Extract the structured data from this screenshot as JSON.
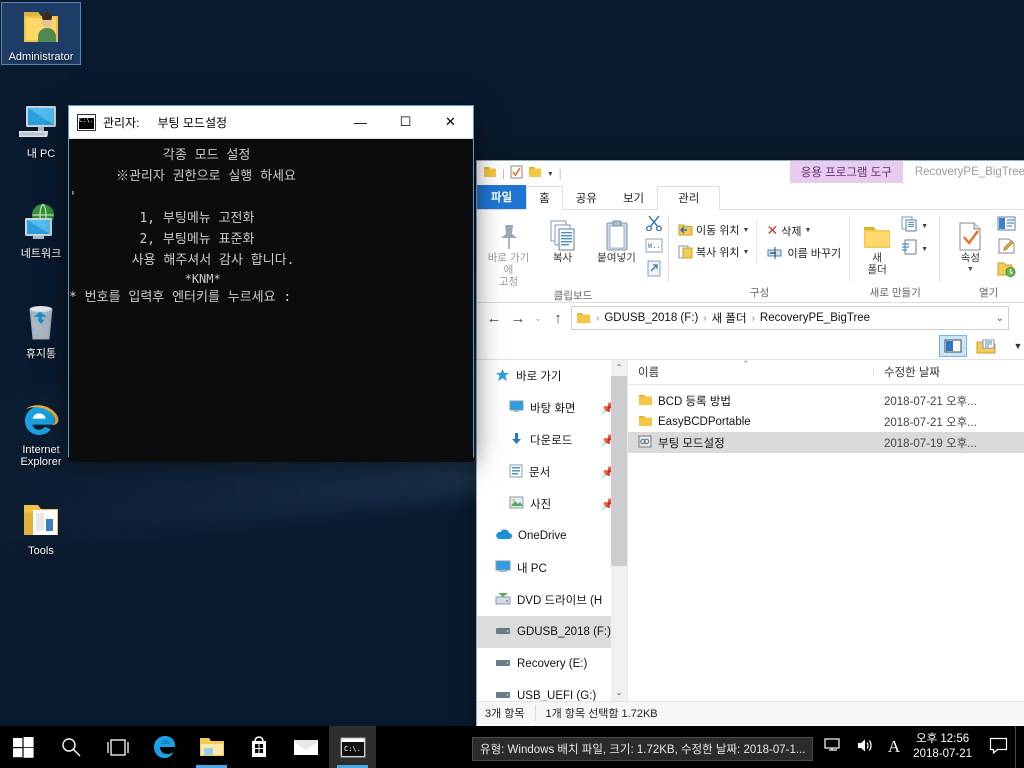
{
  "desktop": {
    "icons": [
      {
        "label": "Administrator",
        "icon": "user-folder-icon",
        "selected": true
      },
      {
        "label": "내 PC",
        "icon": "this-pc-icon",
        "selected": false
      },
      {
        "label": "네트워크",
        "icon": "network-icon",
        "selected": false
      },
      {
        "label": "휴지통",
        "icon": "recycle-bin-icon",
        "selected": false
      },
      {
        "label": "Internet Explorer",
        "icon": "internet-explorer-icon",
        "selected": false
      },
      {
        "label": "Tools",
        "icon": "tools-folder-icon",
        "selected": false
      }
    ]
  },
  "console": {
    "title_prefix": "관리자:",
    "title": "부팅 모드설정",
    "icon": "console-window-icon",
    "minimize": "—",
    "maximize": "☐",
    "close": "✕",
    "lines": [
      "",
      "            각종 모드 설정",
      "",
      "      ※관리자 권한으로 실행 하세요",
      "",
      "'",
      "         1, 부팅메뉴 고전화",
      "",
      "         2, 부팅메뉴 표준화",
      "",
      "",
      "        사용 해주셔서 감사 합니다.",
      "                *KNM*",
      "",
      "* 번호를 입력후 엔터키를 누르세요 :"
    ]
  },
  "explorer": {
    "quick_access": [
      "folder-icon",
      "checkbox-doc-icon",
      "folder-icon",
      "dropdown-icon"
    ],
    "context_tab_label": "응용 프로그램 도구",
    "window_title": "RecoveryPE_BigTree",
    "tabs": [
      {
        "label": "파일",
        "kind": "file"
      },
      {
        "label": "홈",
        "kind": "active"
      },
      {
        "label": "공유",
        "kind": "normal"
      },
      {
        "label": "보기",
        "kind": "normal"
      },
      {
        "label": "관리",
        "kind": "ctx"
      }
    ],
    "ribbon": {
      "groups": [
        {
          "label": "클립보드",
          "big": [
            {
              "label": "바로 가기에\n고정",
              "icon": "pin-icon",
              "dim": true
            },
            {
              "label": "복사",
              "icon": "copy-icon",
              "dim": false
            },
            {
              "label": "붙여넣기",
              "icon": "paste-icon",
              "dim": false
            }
          ],
          "small": [
            {
              "label": "",
              "icon": "cut-icon"
            },
            {
              "label": "",
              "icon": "copy-path-icon"
            },
            {
              "label": "",
              "icon": "paste-shortcut-icon"
            }
          ]
        },
        {
          "label": "구성",
          "small": [
            {
              "label": "이동 위치",
              "icon": "move-to-icon",
              "caret": true
            },
            {
              "label": "복사 위치",
              "icon": "copy-to-icon",
              "caret": true
            },
            {
              "label": "삭제",
              "icon": "delete-x-icon",
              "caret": true
            },
            {
              "label": "이름 바꾸기",
              "icon": "rename-icon",
              "caret": false
            }
          ]
        },
        {
          "label": "새로 만들기",
          "big": [
            {
              "label": "새\n폴더",
              "icon": "new-folder-icon",
              "dim": false
            }
          ],
          "small": [
            {
              "label": "",
              "icon": "new-item-icon",
              "caret": true
            },
            {
              "label": "",
              "icon": "easy-access-icon",
              "caret": true
            }
          ]
        },
        {
          "label": "열기",
          "big": [
            {
              "label": "속성",
              "icon": "properties-icon",
              "dim": false,
              "caret": true
            }
          ],
          "small": [
            {
              "label": "",
              "icon": "open-icon"
            },
            {
              "label": "",
              "icon": "edit-icon"
            },
            {
              "label": "",
              "icon": "history-icon"
            }
          ]
        }
      ]
    },
    "addressbar": {
      "back": "←",
      "forward": "→",
      "recent": "⌄",
      "up": "↑",
      "crumbs": [
        "GDUSB_2018 (F:)",
        "새 폴더",
        "RecoveryPE_BigTree"
      ],
      "crumb_sep": "›",
      "dropdown": "⌄"
    },
    "viewbuttons": [
      {
        "icon": "details-pane-icon",
        "active": true
      },
      {
        "icon": "preview-layout-icon",
        "active": false
      },
      {
        "icon": "options-caret-icon",
        "active": false
      }
    ],
    "navpane": {
      "items": [
        {
          "label": "바로 가기",
          "icon": "quick-access-star-icon",
          "indent": false,
          "pin": false,
          "selected": false
        },
        {
          "label": "바탕 화면",
          "icon": "desktop-icon",
          "indent": true,
          "pin": true,
          "selected": false
        },
        {
          "label": "다운로드",
          "icon": "downloads-icon",
          "indent": true,
          "pin": true,
          "selected": false
        },
        {
          "label": "문서",
          "icon": "documents-icon",
          "indent": true,
          "pin": true,
          "selected": false
        },
        {
          "label": "사진",
          "icon": "pictures-icon",
          "indent": true,
          "pin": true,
          "selected": false
        },
        {
          "label": "OneDrive",
          "icon": "onedrive-icon",
          "indent": false,
          "pin": false,
          "selected": false
        },
        {
          "label": "내 PC",
          "icon": "this-pc-icon",
          "indent": false,
          "pin": false,
          "selected": false
        },
        {
          "label": "DVD 드라이브 (H",
          "icon": "dvd-drive-icon",
          "indent": false,
          "pin": false,
          "selected": false
        },
        {
          "label": "GDUSB_2018 (F:)",
          "icon": "usb-drive-icon",
          "indent": false,
          "pin": false,
          "selected": true
        },
        {
          "label": "Recovery (E:)",
          "icon": "drive-icon",
          "indent": false,
          "pin": false,
          "selected": false
        },
        {
          "label": "USB_UEFI (G:)",
          "icon": "usb-drive-icon",
          "indent": false,
          "pin": false,
          "selected": false
        }
      ],
      "scroll_up": "⌃",
      "scroll_down": "⌄"
    },
    "columns": [
      "이름",
      "수정한 날짜"
    ],
    "rows": [
      {
        "name": "BCD 등록 방법",
        "icon": "folder-icon",
        "date": "2018-07-21 오후...",
        "selected": false
      },
      {
        "name": "EasyBCDPortable",
        "icon": "folder-icon",
        "date": "2018-07-21 오후...",
        "selected": false
      },
      {
        "name": "부팅 모드설정",
        "icon": "batch-file-icon",
        "date": "2018-07-19 오후...",
        "selected": true
      }
    ],
    "status": {
      "count": "3개 항목",
      "selection": "1개 항목 선택함  1.72KB"
    }
  },
  "tooltip": {
    "text": "유형: Windows 배치 파일, 크기: 1.72KB, 수정한 날짜: 2018-07-1..."
  },
  "taskbar": {
    "buttons": [
      {
        "icon": "windows-start-icon",
        "state": "none"
      },
      {
        "icon": "search-icon",
        "state": "none"
      },
      {
        "icon": "task-view-icon",
        "state": "none"
      },
      {
        "icon": "edge-icon",
        "state": "none"
      },
      {
        "icon": "file-explorer-icon",
        "state": "open"
      },
      {
        "icon": "store-icon",
        "state": "none"
      },
      {
        "icon": "mail-icon",
        "state": "none"
      },
      {
        "icon": "console-icon",
        "state": "run"
      }
    ],
    "tray": [
      {
        "icon": "people-icon"
      },
      {
        "icon": "show-hidden-icons-icon"
      },
      {
        "icon": "network-tray-icon"
      },
      {
        "icon": "volume-icon"
      },
      {
        "icon": "ime-icon"
      }
    ],
    "clock_time": "오후 12:56",
    "clock_date": "2018-07-21",
    "action_center": "action-center-icon"
  },
  "colors": {
    "accent": "#1f76d2",
    "context_tab_bg": "#e8ccf0",
    "selection": "#dadada",
    "console_bg": "#0c0c0c"
  }
}
